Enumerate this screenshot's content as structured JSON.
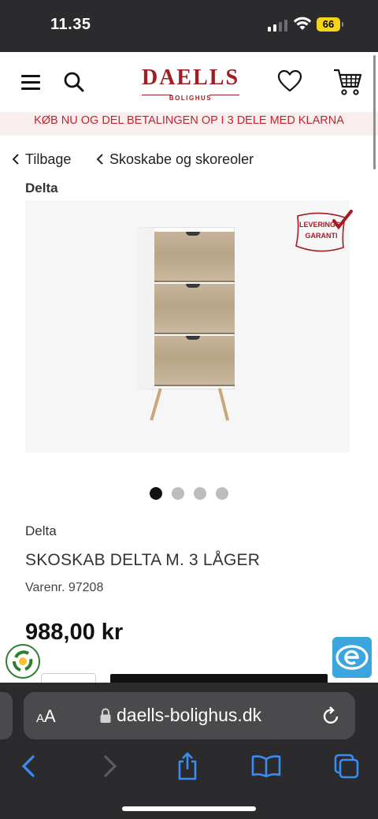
{
  "status": {
    "time": "11.35",
    "battery": "66"
  },
  "header": {
    "logo_brand": "DAELLS",
    "logo_sub": "BOLIGHUS",
    "menu_icon": "hamburger-icon",
    "search_icon": "search-icon",
    "wishlist_icon": "heart-icon",
    "cart_icon": "cart-icon"
  },
  "banner": {
    "text": "KØB NU OG DEL BETALINGEN OP I 3 DELE MED KLARNA"
  },
  "breadcrumb": {
    "back": "Tilbage",
    "category": "Skoskabe og skoreoler"
  },
  "product": {
    "brand_top": "Delta",
    "brand": "Delta",
    "title": "SKOSKAB DELTA M. 3 LÅGER",
    "sku": "Varenr. 97208",
    "price": "988,00 kr",
    "badge_line1": "LEVERINGS",
    "badge_line2": "GARANTI",
    "gallery_total": 4,
    "gallery_active": 1
  },
  "browser": {
    "aa_label_small": "A",
    "aa_label": "A",
    "url": "daells-bolighus.dk"
  },
  "colors": {
    "brand_red": "#a01d24",
    "banner_bg": "#f9eeee",
    "banner_text": "#c0242e",
    "safari_blue": "#3a8cf3"
  }
}
